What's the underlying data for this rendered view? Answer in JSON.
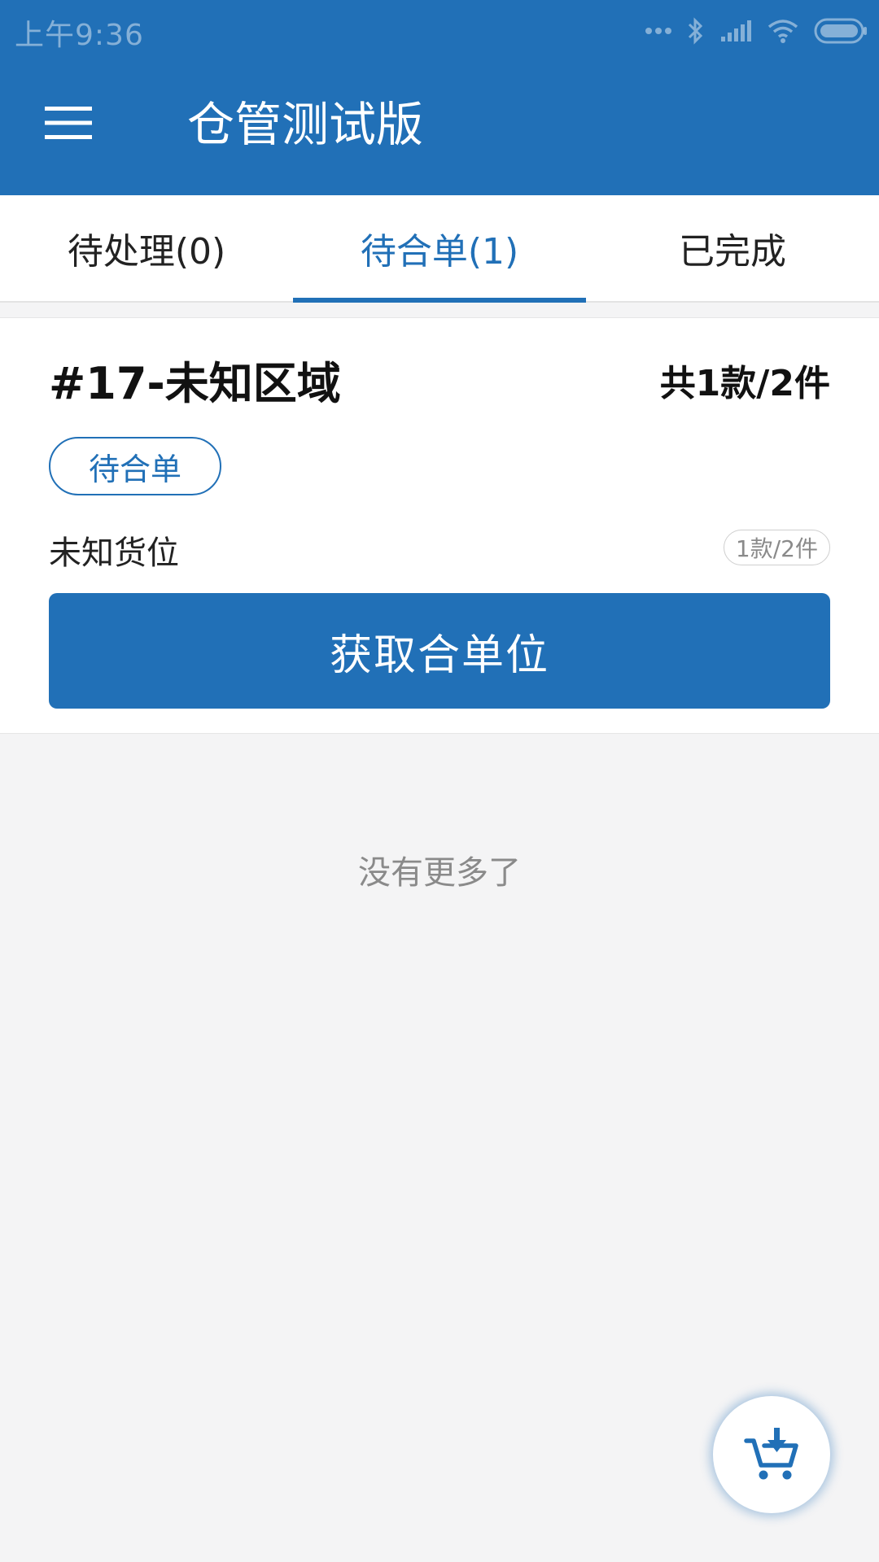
{
  "status_bar": {
    "time": "上午9:36"
  },
  "app_bar": {
    "title": "仓管测试版",
    "menu_icon": "hamburger-menu-icon"
  },
  "tabs": [
    {
      "label": "待处理(0)",
      "active": false
    },
    {
      "label": "待合单(1)",
      "active": true
    },
    {
      "label": "已完成",
      "active": false
    }
  ],
  "card": {
    "title": "#17-未知区域",
    "total": "共1款/2件",
    "status_label": "待合单",
    "location": "未知货位",
    "location_badge": "1款/2件",
    "action_button": "获取合单位"
  },
  "list_footer": "没有更多了",
  "fab": {
    "icon": "cart-download-icon"
  },
  "colors": {
    "primary": "#2170b7",
    "background": "#f4f4f5"
  }
}
